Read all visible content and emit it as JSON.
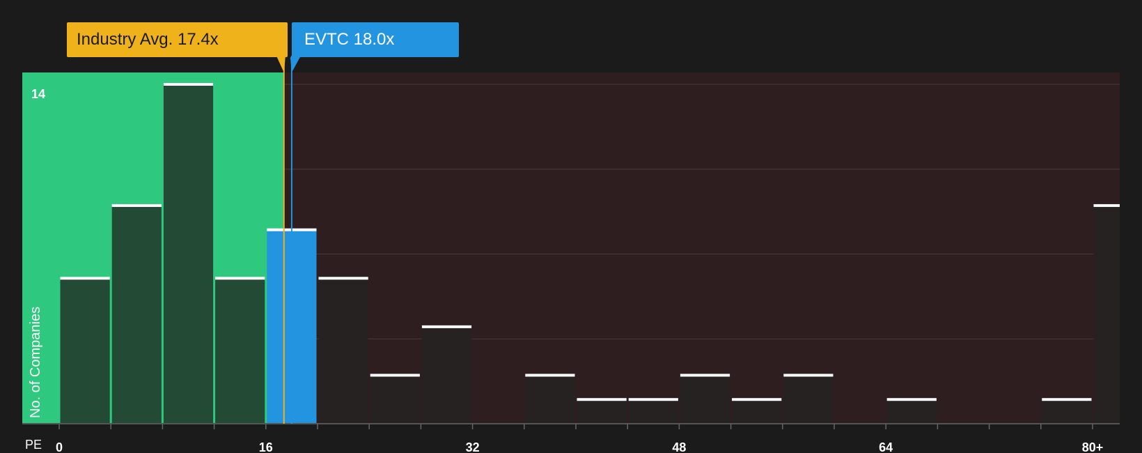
{
  "chart_data": {
    "type": "bar",
    "xlabel": "PE",
    "ylabel": "No. of Companies",
    "x_tick_labels": [
      "0",
      "16",
      "32",
      "48",
      "64",
      "80+"
    ],
    "x_tick_values": [
      0,
      16,
      32,
      48,
      64,
      80
    ],
    "y_tick_label": "14",
    "ylim": [
      0,
      14
    ],
    "xlim": [
      -3,
      82
    ],
    "bin_width": 4,
    "bins": [
      {
        "start": 0,
        "value": 6
      },
      {
        "start": 4,
        "value": 9
      },
      {
        "start": 8,
        "value": 14
      },
      {
        "start": 12,
        "value": 6
      },
      {
        "start": 16,
        "value": 8,
        "highlight": true
      },
      {
        "start": 20,
        "value": 6
      },
      {
        "start": 24,
        "value": 2
      },
      {
        "start": 28,
        "value": 4
      },
      {
        "start": 32,
        "value": 0
      },
      {
        "start": 36,
        "value": 2
      },
      {
        "start": 40,
        "value": 1
      },
      {
        "start": 44,
        "value": 1
      },
      {
        "start": 48,
        "value": 2
      },
      {
        "start": 52,
        "value": 1
      },
      {
        "start": 56,
        "value": 2
      },
      {
        "start": 60,
        "value": 0
      },
      {
        "start": 64,
        "value": 1
      },
      {
        "start": 68,
        "value": 0
      },
      {
        "start": 72,
        "value": 0
      },
      {
        "start": 76,
        "value": 1
      },
      {
        "start": 80,
        "value": 9
      }
    ],
    "industry_avg": {
      "label": "Industry Avg. 17.4x",
      "value": 17.4
    },
    "company": {
      "label": "EVTC 18.0x",
      "value": 18.0
    },
    "grid": true
  },
  "colors": {
    "background": "#1b1b1b",
    "undervalued_zone": "#2ec87f",
    "overvalued_zone": "#2f1e1f",
    "bar_in_green": "#234a35",
    "bar_default": "#272222",
    "bar_highlight": "#2394e0",
    "industry": "#f0b21a",
    "company": "#2394e0"
  }
}
